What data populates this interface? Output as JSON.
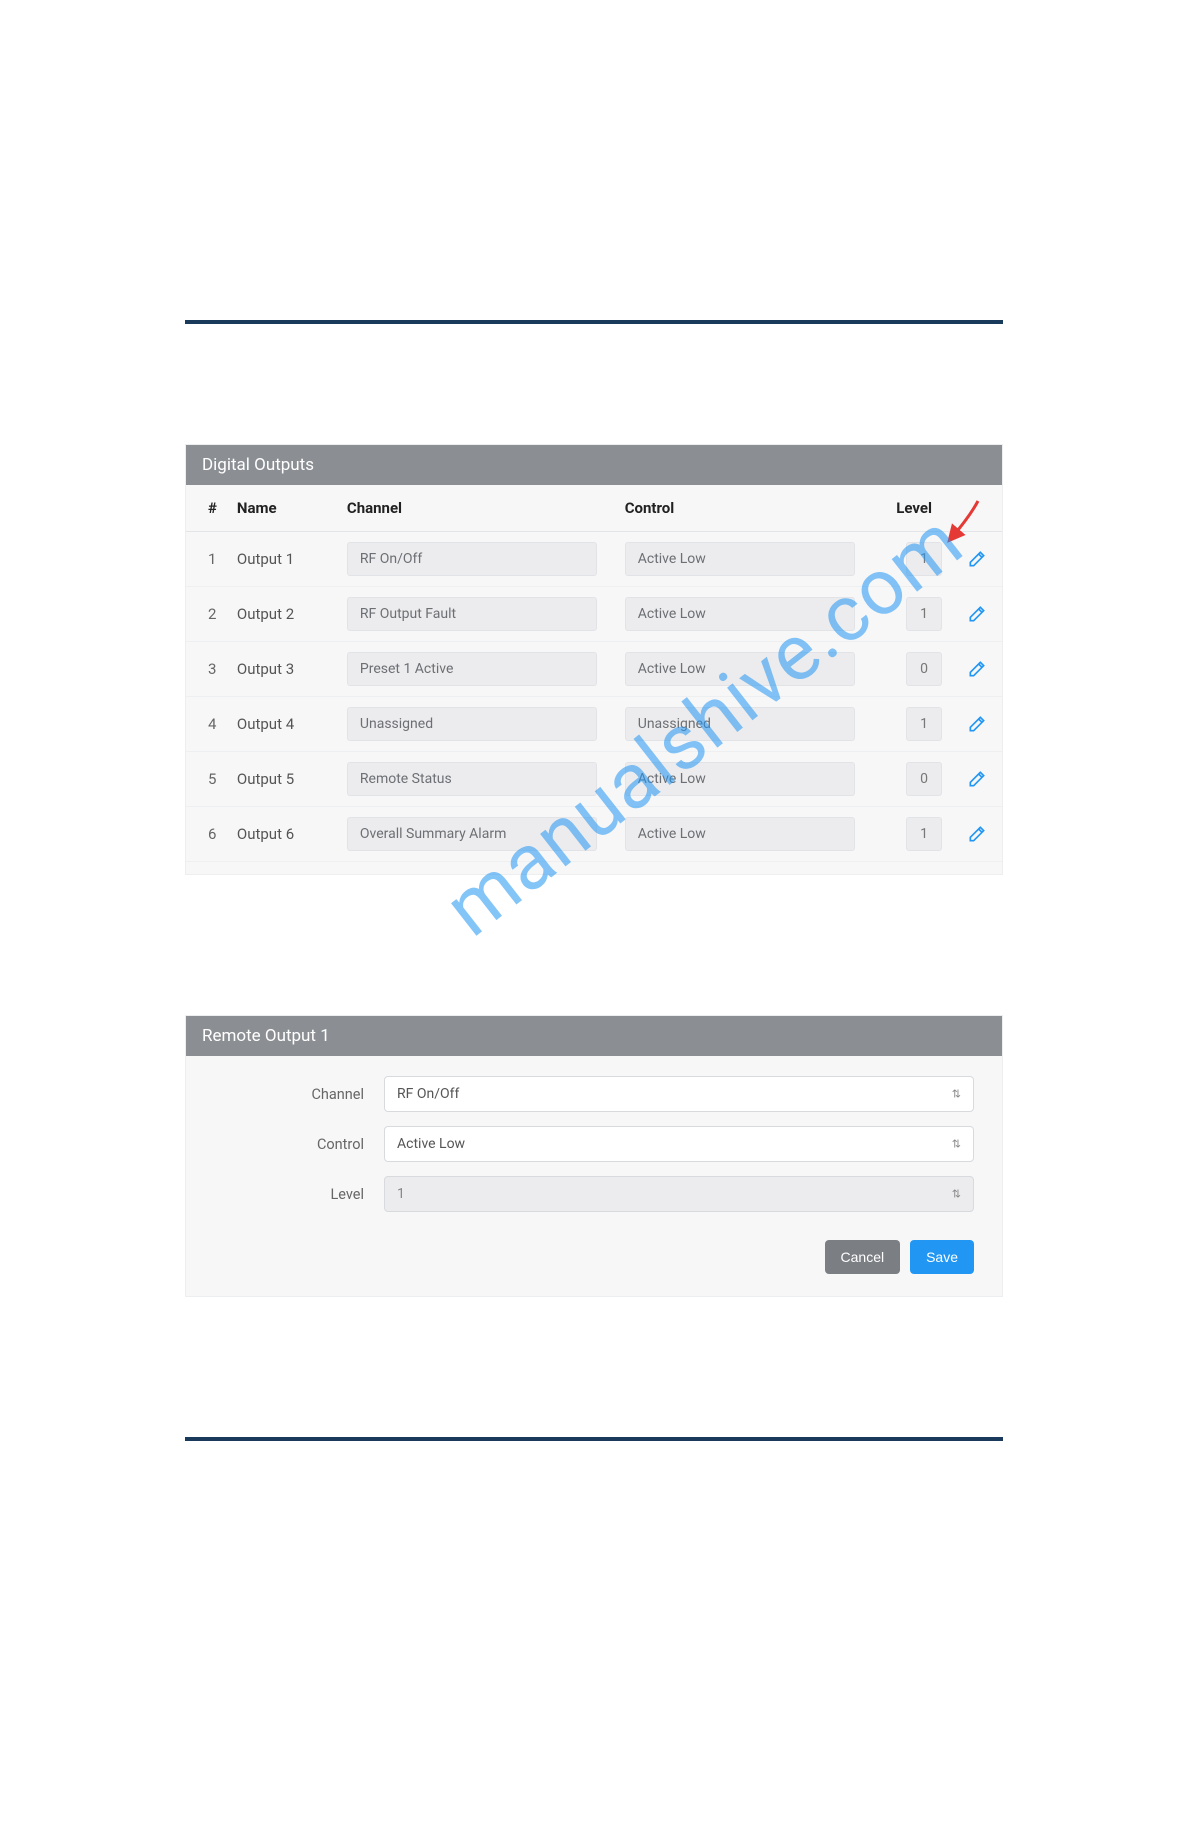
{
  "table_panel": {
    "title": "Digital Outputs",
    "headers": {
      "num": "#",
      "name": "Name",
      "channel": "Channel",
      "control": "Control",
      "level": "Level"
    },
    "rows": [
      {
        "num": "1",
        "name": "Output 1",
        "channel": "RF On/Off",
        "control": "Active Low",
        "level": "1"
      },
      {
        "num": "2",
        "name": "Output 2",
        "channel": "RF Output Fault",
        "control": "Active Low",
        "level": "1"
      },
      {
        "num": "3",
        "name": "Output 3",
        "channel": "Preset 1 Active",
        "control": "Active Low",
        "level": "0"
      },
      {
        "num": "4",
        "name": "Output 4",
        "channel": "Unassigned",
        "control": "Unassigned",
        "level": "1"
      },
      {
        "num": "5",
        "name": "Output 5",
        "channel": "Remote Status",
        "control": "Active Low",
        "level": "0"
      },
      {
        "num": "6",
        "name": "Output 6",
        "channel": "Overall Summary Alarm",
        "control": "Active Low",
        "level": "1"
      }
    ]
  },
  "form_panel": {
    "title": "Remote Output 1",
    "channel_label": "Channel",
    "channel_value": "RF On/Off",
    "control_label": "Control",
    "control_value": "Active Low",
    "level_label": "Level",
    "level_value": "1",
    "cancel_label": "Cancel",
    "save_label": "Save"
  },
  "watermark": "manualshive.com"
}
